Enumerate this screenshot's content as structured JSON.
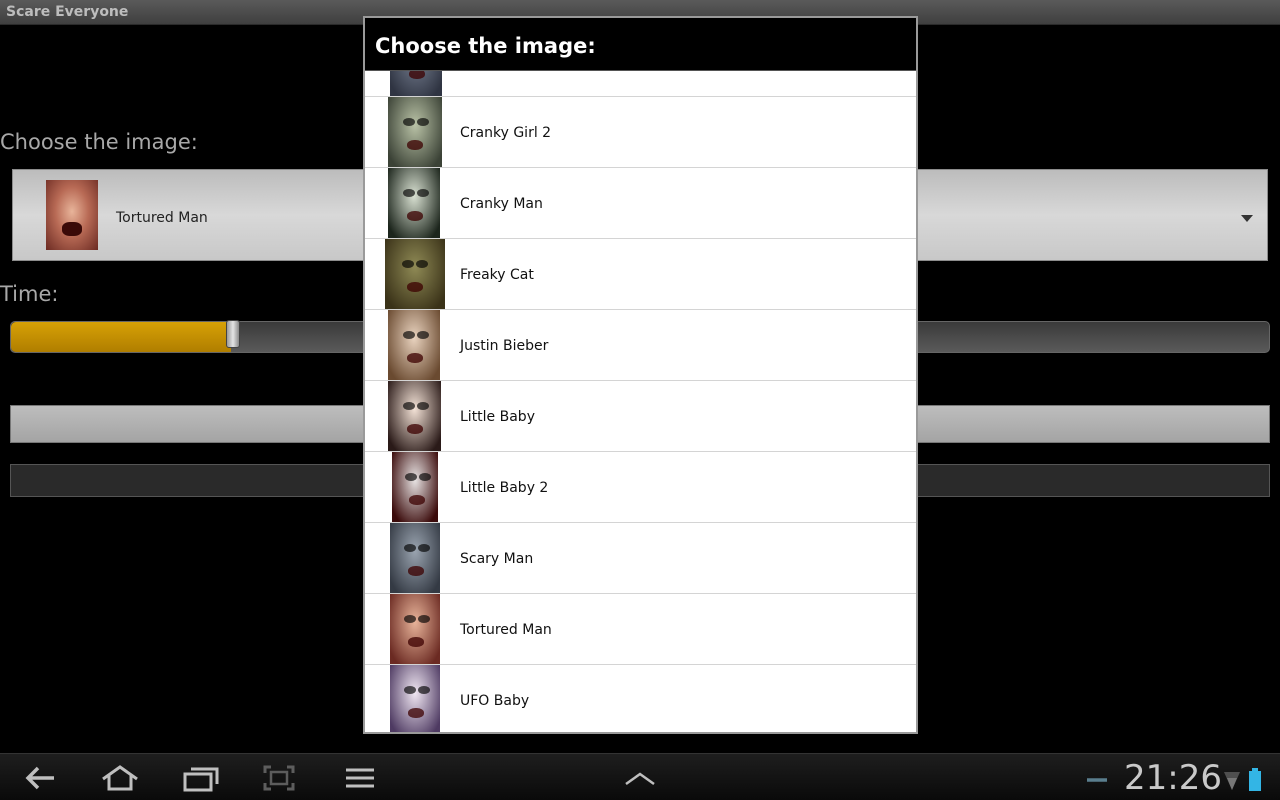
{
  "app": {
    "title": "Scare Everyone",
    "choose_label": "Choose the image:",
    "selected_image": "Tortured Man",
    "time_label": "Time:",
    "time_progress_fraction": 0.175
  },
  "dialog": {
    "title": "Choose the image:",
    "items": [
      {
        "label": "",
        "colors": [
          "#7b8496",
          "#2f3442"
        ]
      },
      {
        "label": "Cranky Girl 2",
        "colors": [
          "#b9c2a6",
          "#3b4236"
        ]
      },
      {
        "label": "Cranky Man",
        "colors": [
          "#d9e1d2",
          "#1c251c"
        ]
      },
      {
        "label": "Freaky Cat",
        "colors": [
          "#8f8a55",
          "#3a3218"
        ]
      },
      {
        "label": "Justin Bieber",
        "colors": [
          "#e9d3bf",
          "#6a4a30"
        ]
      },
      {
        "label": "Little Baby",
        "colors": [
          "#f3e2d6",
          "#2a1a18"
        ]
      },
      {
        "label": "Little Baby 2",
        "colors": [
          "#e8e4e4",
          "#3a0a0a"
        ]
      },
      {
        "label": "Scary Man",
        "colors": [
          "#9aa4b0",
          "#343a44"
        ]
      },
      {
        "label": "Tortured Man",
        "colors": [
          "#e8b49a",
          "#6b2a22"
        ]
      },
      {
        "label": "UFO Baby",
        "colors": [
          "#f0e7f2",
          "#4e3a62"
        ]
      }
    ]
  },
  "status": {
    "time": "21:26"
  },
  "colors": {
    "accent": "#33b5e5",
    "progress": "#d7a106"
  }
}
